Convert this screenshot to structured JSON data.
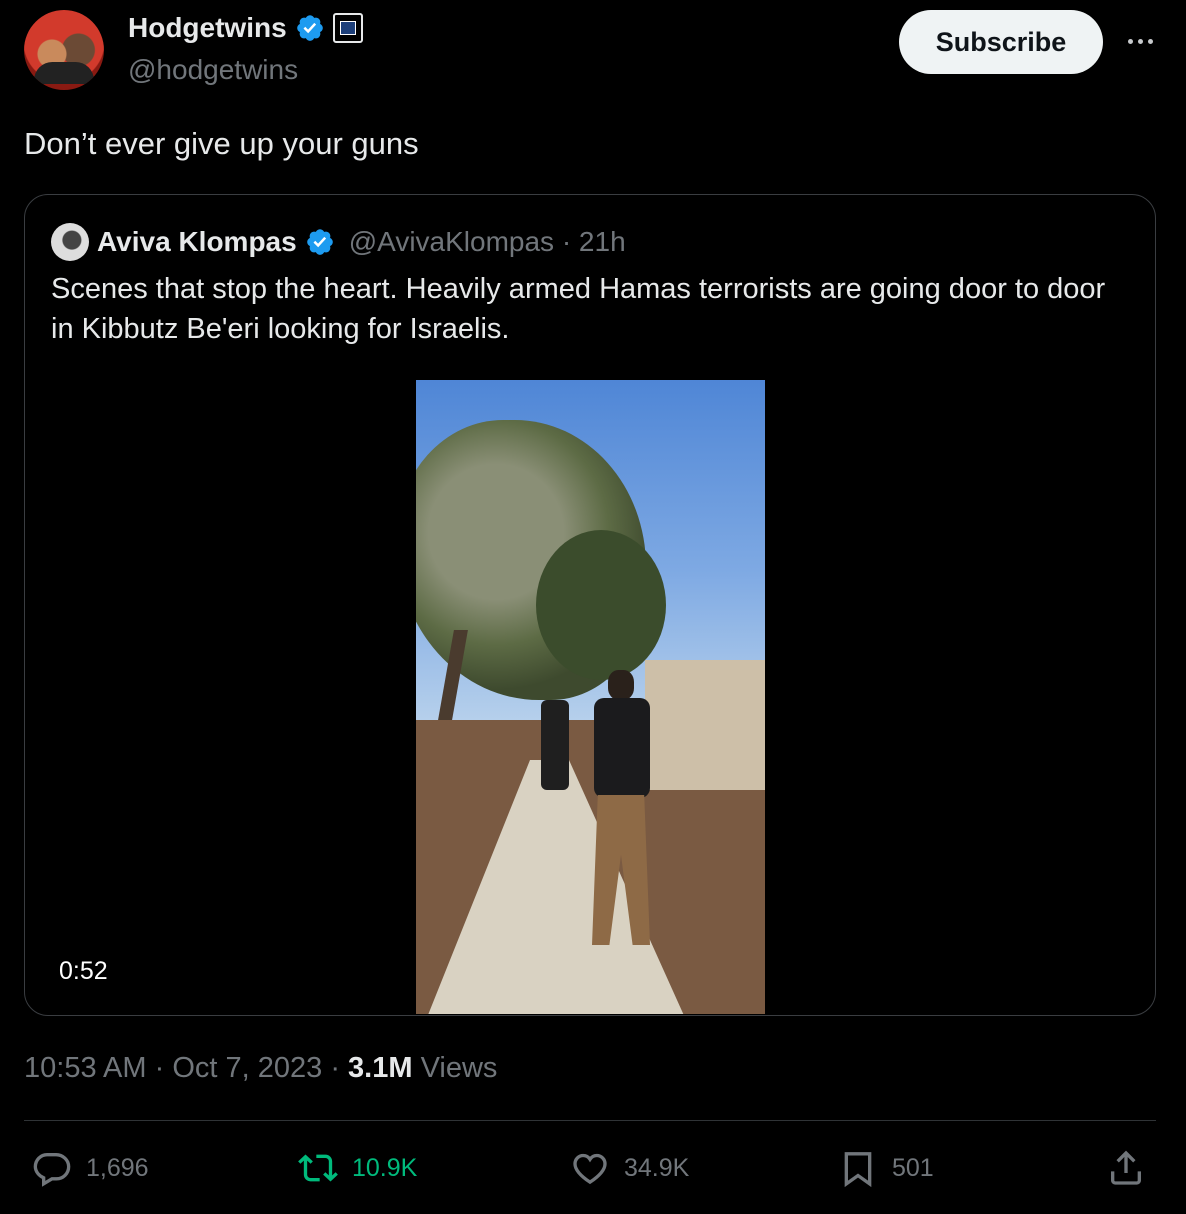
{
  "author": {
    "display_name": "Hodgetwins",
    "handle": "@hodgetwins",
    "verified": true
  },
  "subscribe_label": "Subscribe",
  "tweet_text": "Don’t ever give up your guns",
  "quoted": {
    "display_name": "Aviva Klompas",
    "handle": "@AvivaKlompas",
    "age": "21h",
    "meta": "@AvivaKlompas · 21h",
    "text": "Scenes that stop the heart. Heavily armed Hamas terrorists are going door to door in Kibbutz Be'eri looking for Israelis.",
    "video_duration": "0:52"
  },
  "timestamp": {
    "time": "10:53 AM",
    "date": "Oct 7, 2023",
    "views_count": "3.1M",
    "views_label": "Views"
  },
  "actions": {
    "replies": "1,696",
    "retweets": "10.9K",
    "likes": "34.9K",
    "bookmarks": "501"
  },
  "colors": {
    "background": "#000000",
    "text_primary": "#e7e9ea",
    "text_secondary": "#71767b",
    "verified_blue": "#1d9bf0",
    "retweet_green": "#00ba7c"
  },
  "icons": [
    "verified-badge-icon",
    "affiliate-badge-icon",
    "more-icon",
    "reply-icon",
    "retweet-icon",
    "like-icon",
    "bookmark-icon",
    "share-icon"
  ]
}
